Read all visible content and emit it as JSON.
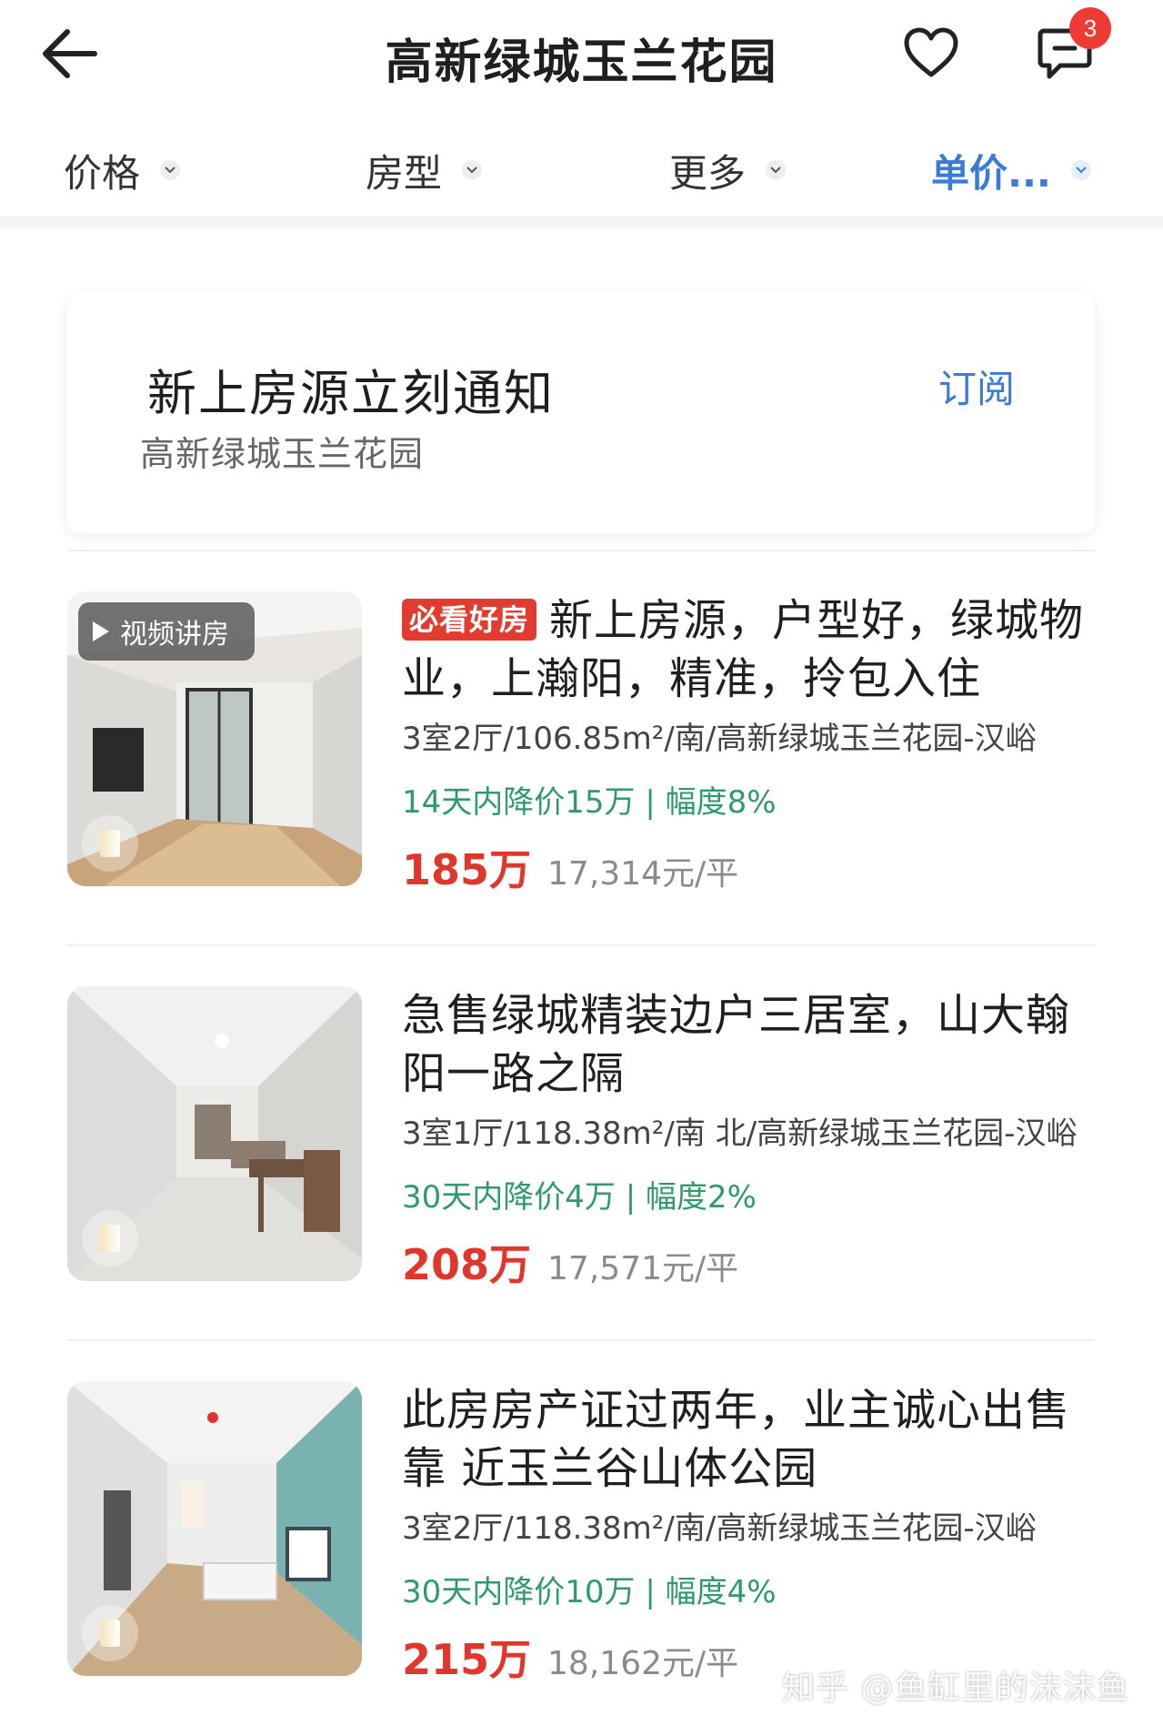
{
  "header": {
    "title": "高新绿城玉兰花园",
    "back_icon": "arrow-left-icon",
    "favorite_icon": "heart-icon",
    "message_icon": "chat-icon",
    "message_badge": "3"
  },
  "filters": [
    {
      "label": "价格",
      "active": false
    },
    {
      "label": "房型",
      "active": false
    },
    {
      "label": "更多",
      "active": false
    },
    {
      "label": "单价...",
      "active": true
    }
  ],
  "subscribe": {
    "title": "新上房源立刻通知",
    "community": "高新绿城玉兰花园",
    "button": "订阅"
  },
  "listings": [
    {
      "badge": "必看好房",
      "video_tag": "视频讲房",
      "title": "新上房源，户型好，绿城物业，上瀚阳，精准，拎包入住",
      "specs": "3室2厅/106.85m²/南/高新绿城玉兰花园-汉峪",
      "price_drop": "14天内降价15万 | 幅度8%",
      "price": "185万",
      "unit_price": "17,314元/平"
    },
    {
      "badge": "",
      "video_tag": "",
      "title": "急售绿城精装边户三居室，山大翰阳一路之隔",
      "specs": "3室1厅/118.38m²/南 北/高新绿城玉兰花园-汉峪",
      "price_drop": "30天内降价4万 | 幅度2%",
      "price": "208万",
      "unit_price": "17,571元/平"
    },
    {
      "badge": "",
      "video_tag": "",
      "title": "此房房产证过两年，业主诚心出售靠 近玉兰谷山体公园",
      "specs": "3室2厅/118.38m²/南/高新绿城玉兰花园-汉峪",
      "price_drop": "30天内降价10万 | 幅度4%",
      "price": "215万",
      "unit_price": "18,162元/平"
    }
  ],
  "watermark": "知乎 @鱼缸里的沫沫鱼",
  "colors": {
    "accent_blue": "#3b7ad6",
    "price_red": "#e0362c",
    "drop_green": "#2f9a6c",
    "badge_red": "#e33b2f"
  }
}
